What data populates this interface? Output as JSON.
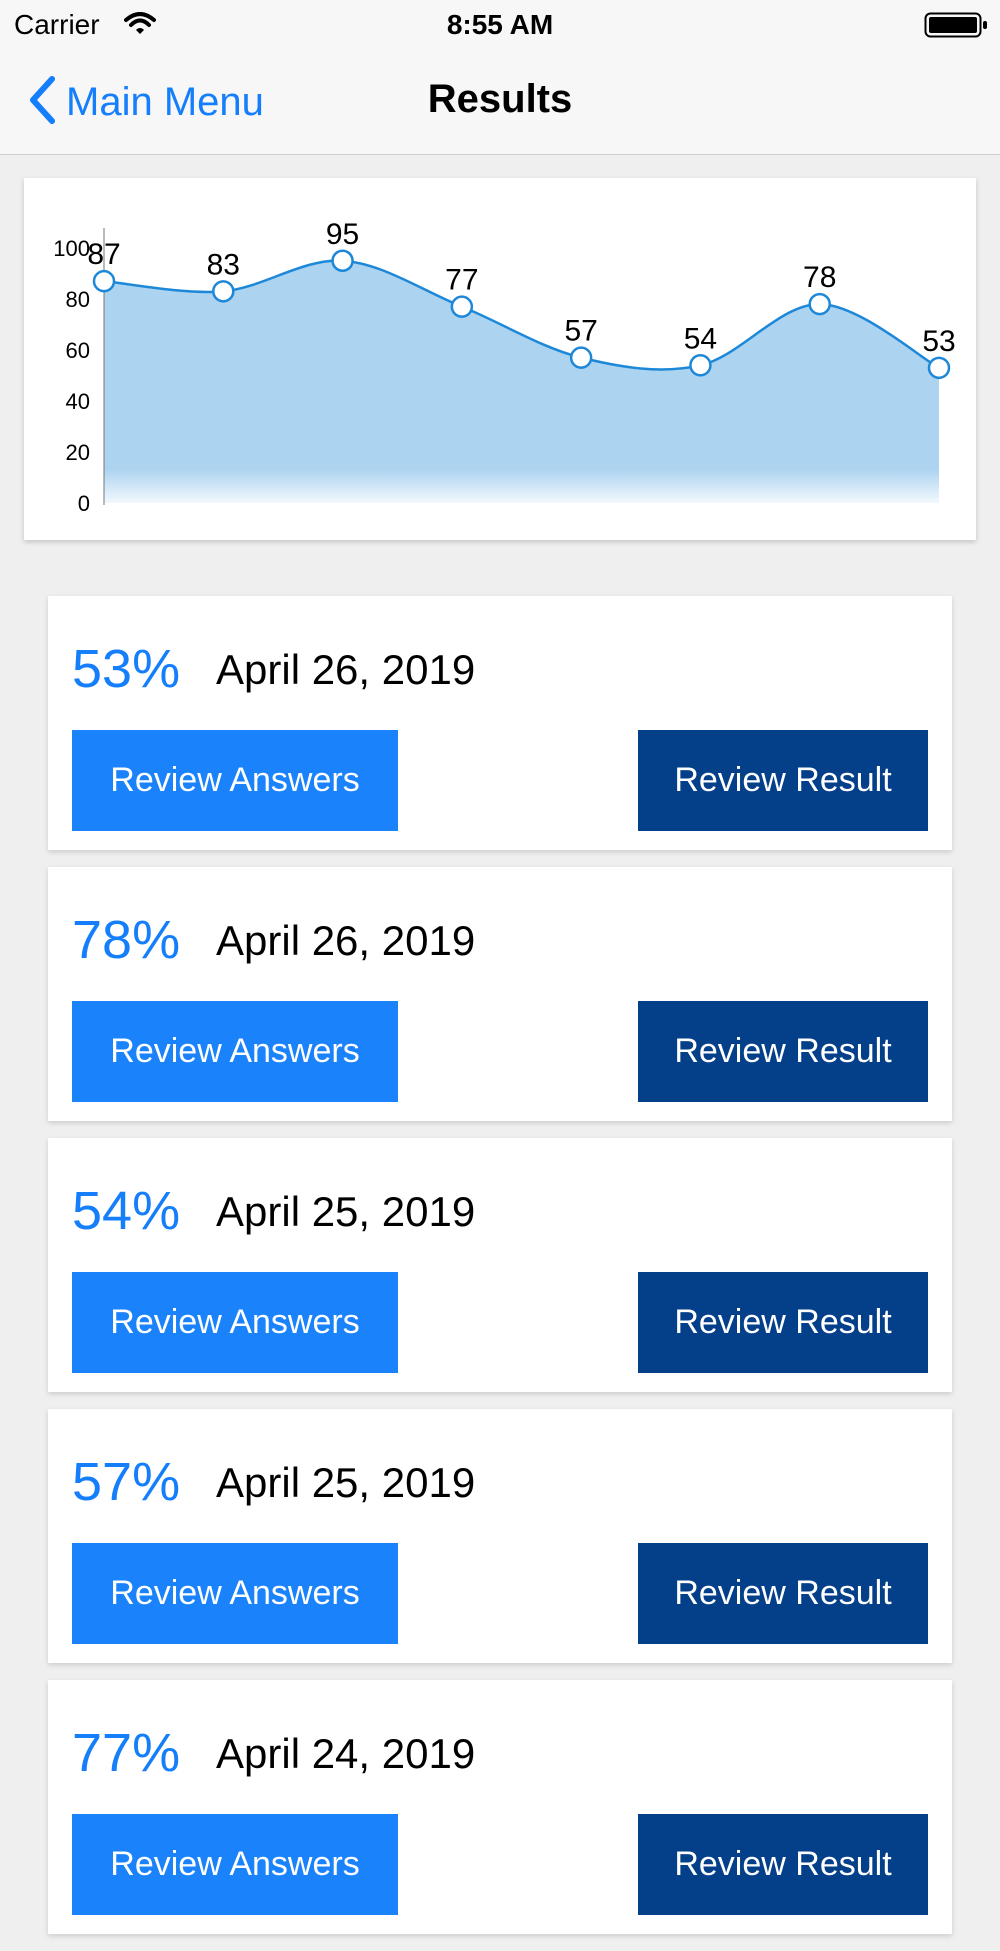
{
  "status_bar": {
    "carrier": "Carrier",
    "time": "8:55 AM"
  },
  "nav": {
    "back_label": "Main Menu",
    "title": "Results"
  },
  "colors": {
    "accent": "#147efb",
    "dark_button": "#043f8a",
    "chart_fill": "#acd3f0",
    "chart_line": "#1e88d8"
  },
  "chart_data": {
    "type": "area",
    "x": [
      1,
      2,
      3,
      4,
      5,
      6,
      7,
      8
    ],
    "values": [
      87,
      83,
      95,
      77,
      57,
      54,
      78,
      53
    ],
    "ylim": [
      0,
      100
    ],
    "yticks": [
      "0",
      "20",
      "40",
      "60",
      "80",
      "100"
    ],
    "grid": false,
    "data_labels": true
  },
  "results": [
    {
      "score": "53%",
      "date": "April 26, 2019",
      "answers_label": "Review Answers",
      "result_label": "Review Result"
    },
    {
      "score": "78%",
      "date": "April 26, 2019",
      "answers_label": "Review Answers",
      "result_label": "Review Result"
    },
    {
      "score": "54%",
      "date": "April 25, 2019",
      "answers_label": "Review Answers",
      "result_label": "Review Result"
    },
    {
      "score": "57%",
      "date": "April 25, 2019",
      "answers_label": "Review Answers",
      "result_label": "Review Result"
    },
    {
      "score": "77%",
      "date": "April 24, 2019",
      "answers_label": "Review Answers",
      "result_label": "Review Result"
    }
  ]
}
